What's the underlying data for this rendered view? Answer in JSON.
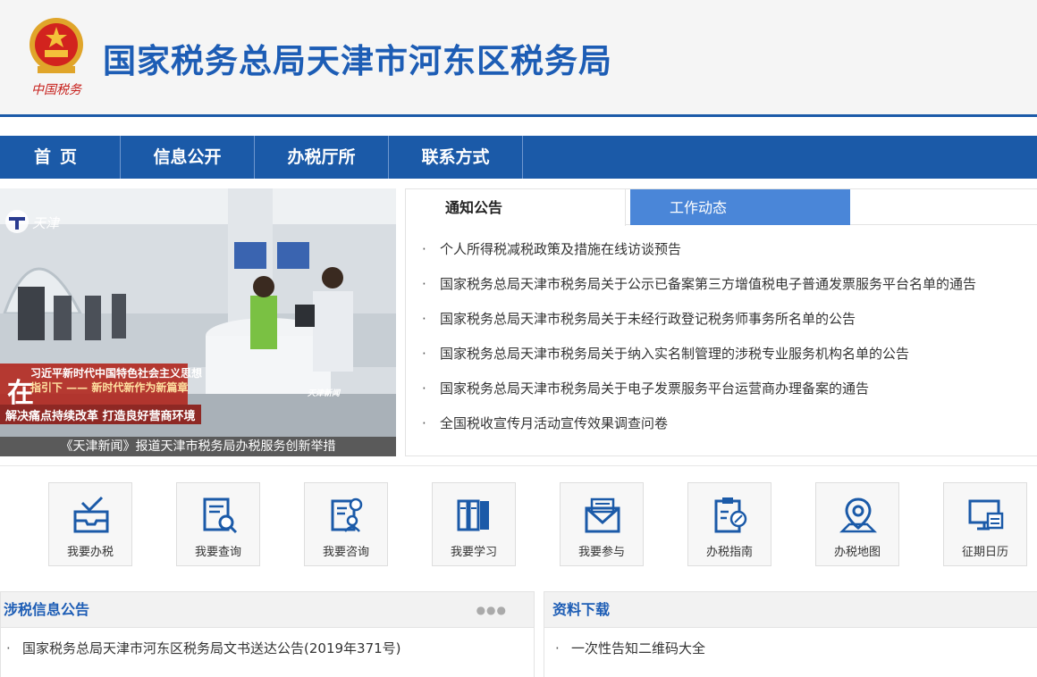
{
  "header": {
    "site_title": "国家税务总局天津市河东区税务局",
    "emblem_text": "中国税务"
  },
  "nav": [
    {
      "label": "首页"
    },
    {
      "label": "信息公开"
    },
    {
      "label": "办税厅所"
    },
    {
      "label": "联系方式"
    }
  ],
  "banner": {
    "caption": "《天津新闻》报道天津市税务局办税服务创新举措",
    "channel_logo": "天津",
    "overlay_line1": "习近平新时代中国特色社会主义思想",
    "overlay_line2": "指引下 —— 新时代新作为新篇章",
    "overlay_big_char": "在",
    "overlay_line3": "解决痛点持续改革 打造良好营商环境",
    "corner_logo": "天津新闻"
  },
  "tabs": {
    "active": "通知公告",
    "inactive": "工作动态"
  },
  "notices": [
    "个人所得税减税政策及措施在线访谈预告",
    "国家税务总局天津市税务局关于公示已备案第三方增值税电子普通发票服务平台名单的通告",
    "国家税务总局天津市税务局关于未经行政登记税务师事务所名单的公告",
    "国家税务总局天津市税务局关于纳入实名制管理的涉税专业服务机构名单的公告",
    "国家税务总局天津市税务局关于电子发票服务平台运营商办理备案的通告",
    "全国税收宣传月活动宣传效果调查问卷"
  ],
  "services": [
    {
      "label": "我要办税",
      "icon": "inbox-check-icon"
    },
    {
      "label": "我要查询",
      "icon": "document-search-icon"
    },
    {
      "label": "我要咨询",
      "icon": "consult-icon"
    },
    {
      "label": "我要学习",
      "icon": "books-icon"
    },
    {
      "label": "我要参与",
      "icon": "envelope-icon"
    },
    {
      "label": "办税指南",
      "icon": "clipboard-compass-icon"
    },
    {
      "label": "办税地图",
      "icon": "map-pin-icon"
    },
    {
      "label": "征期日历",
      "icon": "calendar-monitor-icon"
    }
  ],
  "tax_notices_panel": {
    "title": "涉税信息公告",
    "more": "●●●",
    "items": [
      "国家税务总局天津市河东区税务局文书送达公告(2019年371号)"
    ]
  },
  "downloads_panel": {
    "title": "资料下载",
    "items": [
      "一次性告知二维码大全"
    ]
  },
  "colors": {
    "brand_blue": "#1b5aa8",
    "title_blue": "#1d5db5",
    "tab_blue": "#4a86d8"
  }
}
